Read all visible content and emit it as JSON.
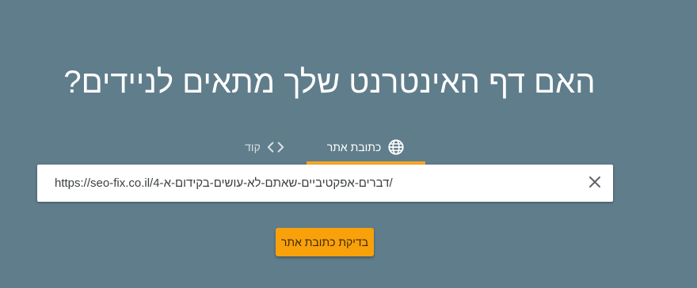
{
  "headline": "האם דף האינטרנט שלך מתאים לניידים?",
  "tabs": [
    {
      "label": "כתובת אתר",
      "icon": "globe-icon",
      "active": true
    },
    {
      "label": "קוד",
      "icon": "code-icon",
      "active": false
    }
  ],
  "url_field": {
    "value": "https://seo-fix.co.il/4-דברים-אפקטיביים-שאתם-לא-עושים-בקידום-א/",
    "clear_icon": "close-icon"
  },
  "submit_button": {
    "label": "בדיקת כתובת אתר"
  },
  "colors": {
    "background": "#607d8b",
    "accent": "#f9a825",
    "button": "#f9a10b"
  }
}
